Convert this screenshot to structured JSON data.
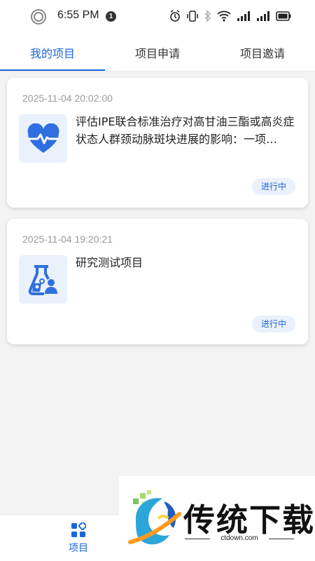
{
  "status_bar": {
    "time": "6:55 PM",
    "notification_count": "1",
    "icons": [
      "alarm-icon",
      "vibrate-icon",
      "bluetooth-icon",
      "wifi-icon",
      "signal-icon",
      "signal-icon",
      "battery-icon"
    ]
  },
  "tabs": [
    {
      "label": "我的项目",
      "active": true
    },
    {
      "label": "项目申请",
      "active": false
    },
    {
      "label": "项目邀请",
      "active": false
    }
  ],
  "projects": [
    {
      "date": "2025-11-04 20:02:00",
      "title": "评估IPE联合标准治疗对高甘油三酯或高炎症状态人群颈动脉斑块进展的影响：一项…",
      "status": "进行中",
      "icon": "heart-pulse-icon"
    },
    {
      "date": "2025-11-04 19:20:21",
      "title": "研究测试项目",
      "status": "进行中",
      "icon": "flask-person-icon"
    }
  ],
  "bottom_nav": {
    "items": [
      {
        "label": "项目",
        "icon": "grid-icon",
        "active": true
      }
    ]
  },
  "watermark": {
    "text": "传统下载",
    "domain": "ctdown.com"
  },
  "colors": {
    "accent": "#1a66d9",
    "background": "#f3f3f3",
    "status_bg": "#eaf1fb"
  }
}
